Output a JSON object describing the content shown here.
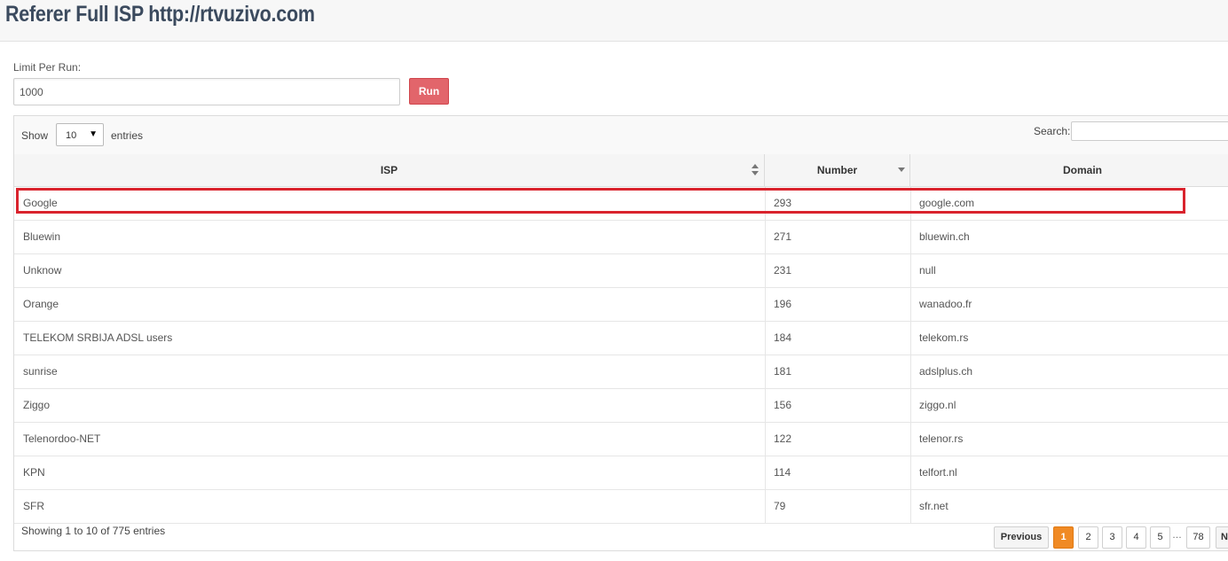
{
  "page": {
    "title": "Referer Full ISP http://rtvuzivo.com"
  },
  "form": {
    "limit_label": "Limit Per Run:",
    "limit_value": "1000",
    "run_label": "Run"
  },
  "table_controls": {
    "show_label": "Show",
    "entries_value": "10",
    "entries_label": "entries",
    "search_label": "Search:"
  },
  "table": {
    "headers": {
      "isp": "ISP",
      "number": "Number",
      "domain": "Domain"
    },
    "rows": [
      {
        "isp": "Google",
        "number": "293",
        "domain": "google.com"
      },
      {
        "isp": "Bluewin",
        "number": "271",
        "domain": "bluewin.ch"
      },
      {
        "isp": "Unknow",
        "number": "231",
        "domain": "null"
      },
      {
        "isp": "Orange",
        "number": "196",
        "domain": "wanadoo.fr"
      },
      {
        "isp": "TELEKOM SRBIJA ADSL users",
        "number": "184",
        "domain": "telekom.rs"
      },
      {
        "isp": "sunrise",
        "number": "181",
        "domain": "adslplus.ch"
      },
      {
        "isp": "Ziggo",
        "number": "156",
        "domain": "ziggo.nl"
      },
      {
        "isp": "Telenordoo-NET",
        "number": "122",
        "domain": "telenor.rs"
      },
      {
        "isp": "KPN",
        "number": "114",
        "domain": "telfort.nl"
      },
      {
        "isp": "SFR",
        "number": "79",
        "domain": "sfr.net"
      }
    ],
    "highlighted_row": 0
  },
  "footer": {
    "info": "Showing 1 to 10 of 775 entries",
    "pagination": {
      "previous": "Previous",
      "pages": [
        "1",
        "2",
        "3",
        "4",
        "5",
        "78"
      ],
      "current": "1",
      "ellipsis": "…",
      "next": "Ne"
    }
  },
  "colors": {
    "accent": "#f08a24",
    "run_button": "#e2656b",
    "highlight": "#d9232d"
  }
}
